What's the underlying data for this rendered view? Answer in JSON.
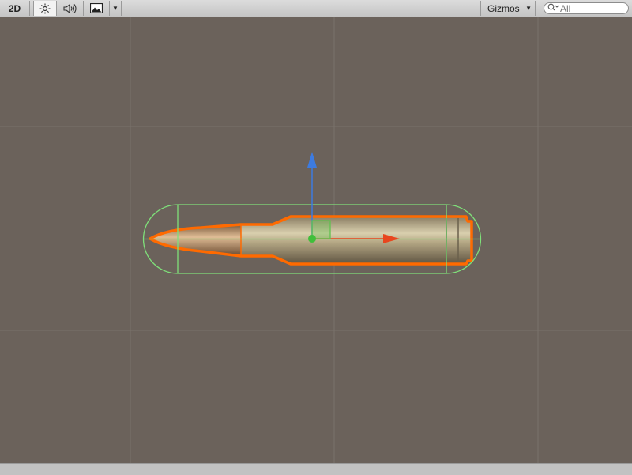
{
  "toolbar": {
    "mode_2d_label": "2D",
    "gizmos_label": "Gizmos",
    "search_placeholder": "All",
    "icons": {
      "lighting": "sun-icon",
      "audio": "speaker-icon",
      "effects": "image-icon",
      "dropdown": "dropdown-arrow-icon",
      "search": "search-icon"
    }
  },
  "scene": {
    "selected_object": "bullet",
    "gizmo_colors": {
      "x_axis": "#e8461e",
      "y_axis": "#3d7be0",
      "collider": "#7fe07a",
      "selection_outline": "#ff6a00"
    }
  }
}
